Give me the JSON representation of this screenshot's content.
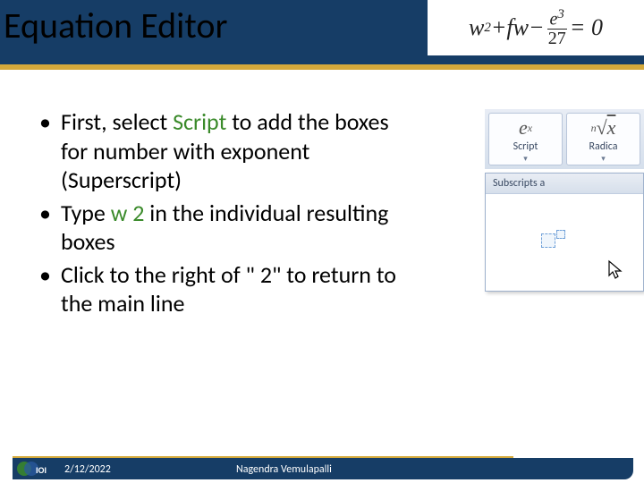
{
  "title": "Equation Editor",
  "equation": {
    "lhs_w": "w",
    "sq": "2",
    "plus": " + ",
    "f": "f",
    "w2": "w",
    "minus": " − ",
    "efrac_num_e": "e",
    "efrac_num_exp": "3",
    "efrac_den": "27",
    "eqzero": " = 0"
  },
  "bullets": {
    "b1a": "First, select ",
    "b1_script": "Script",
    "b1b": " to add the boxes for number with exponent (Superscript)",
    "b2a": "Type ",
    "b2_w": "w",
    "b2_sp": " ",
    "b2_2": "2",
    "b2b": "  in the individual resulting boxes",
    "b3": "Click to the right of \" 2\" to return to the main line"
  },
  "ribbon": {
    "btn1": {
      "ico_base": "e",
      "ico_exp": "x",
      "label": "Script"
    },
    "btn2": {
      "ico_pre": "n",
      "ico_rad": "√",
      "ico_x": "x",
      "label": "Radica"
    },
    "caret": "▾",
    "dropdown_header": "Subscripts a"
  },
  "footer": {
    "date": "2/12/2022",
    "author": "Nagendra Vemulapalli"
  }
}
